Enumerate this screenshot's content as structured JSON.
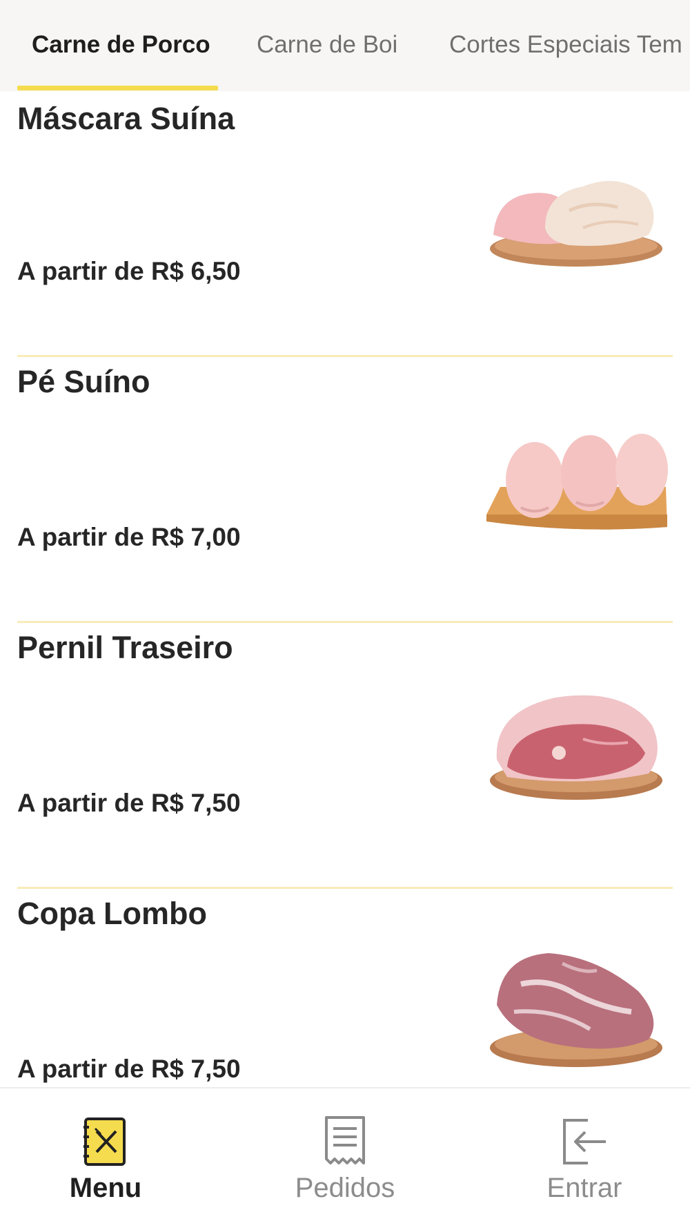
{
  "tabs": [
    {
      "label": "Carne de Porco",
      "active": true
    },
    {
      "label": "Carne de Boi",
      "active": false
    },
    {
      "label": "Cortes Especiais Tem",
      "active": false
    }
  ],
  "products": [
    {
      "name": "Máscara Suína",
      "price": "A partir de R$ 6,50",
      "image": "pork-mask-image"
    },
    {
      "name": "Pé Suíno",
      "price": "A partir de R$ 7,00",
      "image": "pork-feet-image"
    },
    {
      "name": "Pernil Traseiro",
      "price": "A partir de R$ 7,50",
      "image": "pork-leg-image"
    },
    {
      "name": "Copa Lombo",
      "price": "A partir de R$ 7,50",
      "image": "pork-shoulder-image"
    }
  ],
  "bottom_nav": [
    {
      "label": "Menu",
      "icon": "menu-book-icon",
      "active": true
    },
    {
      "label": "Pedidos",
      "icon": "receipt-icon",
      "active": false
    },
    {
      "label": "Entrar",
      "icon": "login-icon",
      "active": false
    }
  ],
  "colors": {
    "accent": "#f5dc4e",
    "divider": "#f8ecb8",
    "tab_bar_bg": "#f7f6f4",
    "inactive_text": "#8c8c8c"
  }
}
